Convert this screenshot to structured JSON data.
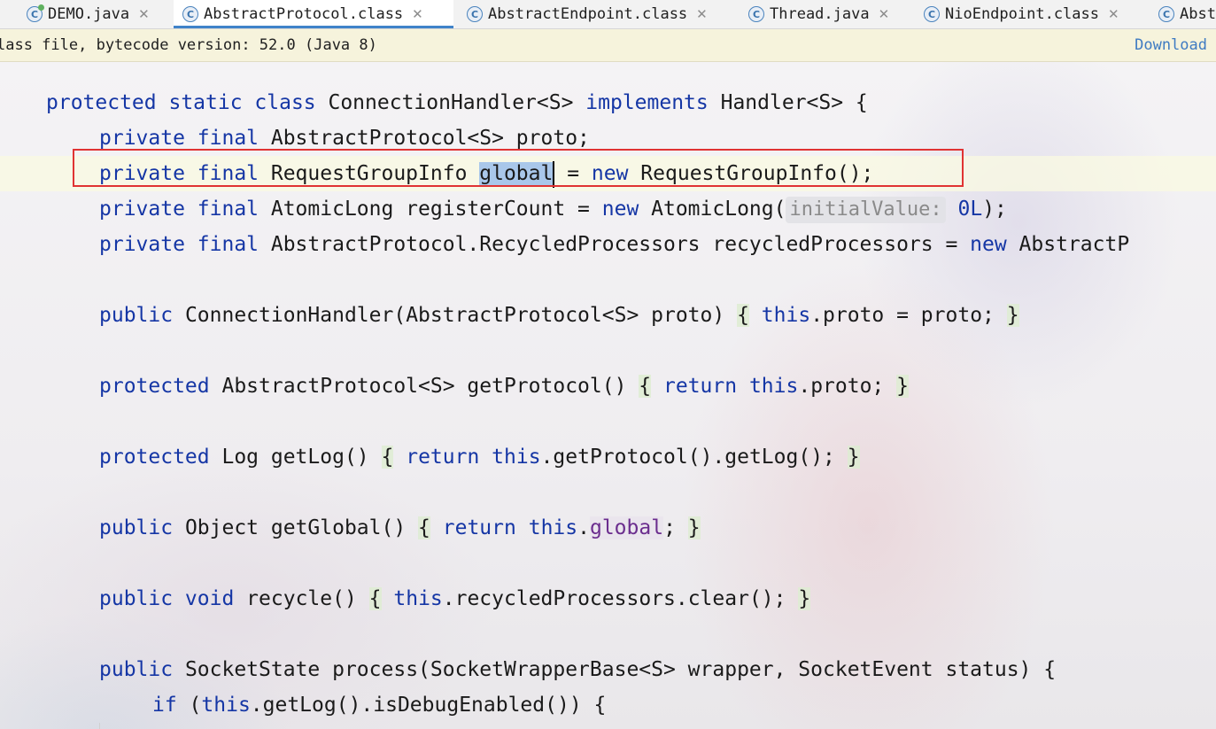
{
  "tabs": [
    {
      "label": "DEMO.java",
      "icon": "java-class-icon"
    },
    {
      "label": "AbstractProtocol.class",
      "icon": "class-file-icon",
      "active": true
    },
    {
      "label": "AbstractEndpoint.class",
      "icon": "class-file-icon"
    },
    {
      "label": "Thread.java",
      "icon": "class-file-icon"
    },
    {
      "label": "NioEndpoint.class",
      "icon": "class-file-icon"
    },
    {
      "label": "Abst",
      "icon": "class-file-icon"
    }
  ],
  "infobar": {
    "message": "lass file, bytecode version: 52.0 (Java 8)",
    "download_label": "Download"
  },
  "code": {
    "l1": {
      "t1": "protected static class",
      "t2": " ConnectionHandler<S> ",
      "t3": "implements",
      "t4": " Handler<S> {"
    },
    "l2": {
      "t1": "private final",
      "t2": " AbstractProtocol<S> proto;"
    },
    "l3": {
      "t1": "private final",
      "t2": " RequestGroupInfo ",
      "sel": "global",
      "t3": " = ",
      "t4": "new",
      "t5": " RequestGroupInfo();"
    },
    "l4": {
      "t1": "private final",
      "t2": " AtomicLong registerCount = ",
      "t3": "new",
      "t4": " AtomicLong(",
      "hint": "initialValue:",
      "num": " 0L",
      "t5": ");"
    },
    "l5": {
      "t1": "private final",
      "t2": " AbstractProtocol.RecycledProcessors recycledProcessors = ",
      "t3": "new",
      "t4": " AbstractP"
    },
    "l6": {
      "t1": "public",
      "t2": " ConnectionHandler(AbstractProtocol<S> proto) ",
      "b1": "{",
      "t3": " ",
      "t4": "this",
      "t5": ".proto = proto; ",
      "b2": "}"
    },
    "l7": {
      "t1": "protected",
      "t2": " AbstractProtocol<S> getProtocol() ",
      "b1": "{",
      "t3": " ",
      "t4": "return",
      "t5": " ",
      "t6": "this",
      "t7": ".proto; ",
      "b2": "}"
    },
    "l8": {
      "t1": "protected",
      "t2": " Log getLog() ",
      "b1": "{",
      "t3": " ",
      "t4": "return",
      "t5": " ",
      "t6": "this",
      "t7": ".getProtocol().getLog(); ",
      "b2": "}"
    },
    "l9": {
      "t1": "public",
      "t2": " Object getGlobal() ",
      "b1": "{",
      "t3": " ",
      "t4": "return",
      "t5": " ",
      "t6": "this",
      "t7": ".",
      "fld": "global",
      "t8": "; ",
      "b2": "}"
    },
    "l10": {
      "t1": "public void",
      "t2": " recycle() ",
      "b1": "{",
      "t3": " ",
      "t4": "this",
      "t5": ".recycledProcessors.clear(); ",
      "b2": "}"
    },
    "l11": {
      "t1": "public",
      "t2": " SocketState process(SocketWrapperBase<S> wrapper, SocketEvent status) {"
    },
    "l12": {
      "t1": "if",
      "t2": " (",
      "t3": "this",
      "t4": ".getLog().isDebugEnabled()) {"
    }
  },
  "colors": {
    "keyword": "#1536a5",
    "field": "#6b2d8e",
    "highlight_box": "#e03333",
    "selection": "#a9c7ea"
  }
}
